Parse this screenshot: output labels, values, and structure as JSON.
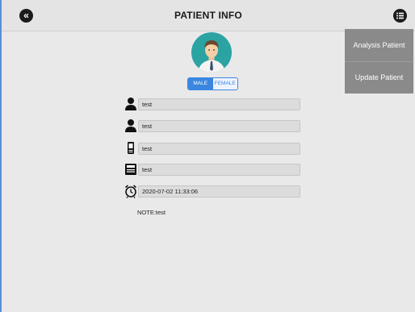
{
  "header": {
    "title": "PATIENT INFO"
  },
  "gender": {
    "male": "MALE",
    "female": "FEMALE",
    "selected": "MALE"
  },
  "fields": [
    {
      "icon": "person-icon",
      "value": "test"
    },
    {
      "icon": "person-icon",
      "value": "test"
    },
    {
      "icon": "phone-icon",
      "value": "test"
    },
    {
      "icon": "id-card-icon",
      "value": "test"
    },
    {
      "icon": "alarm-clock-icon",
      "value": "2020-07-02 11:33:06"
    }
  ],
  "note": "NOTE:test",
  "menu": {
    "items": [
      "Analysis Patient",
      "Update Patient"
    ]
  },
  "colors": {
    "accent": "#3a86e0",
    "menu_bg": "#8a8a8a",
    "background": "#e9e9e9"
  }
}
